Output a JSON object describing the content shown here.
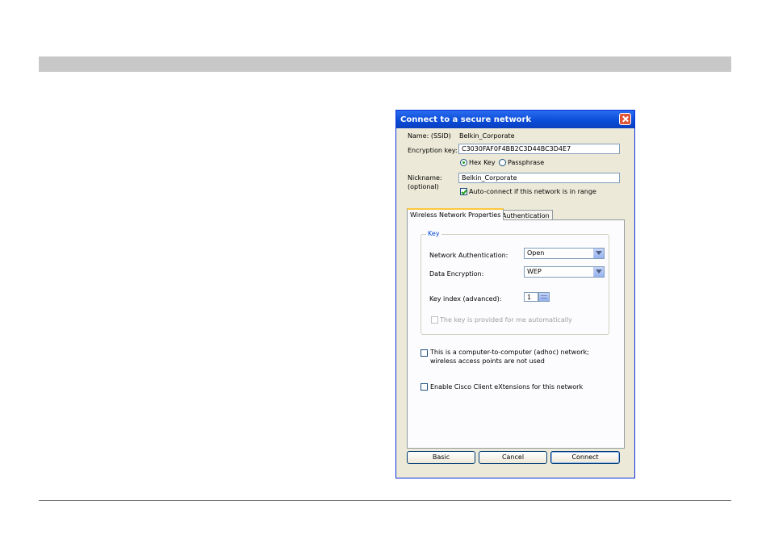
{
  "dialog": {
    "title": "Connect to a secure network",
    "name_label": "Name:  (SSID)",
    "ssid_value": "Belkin_Corporate",
    "encryption_label": "Encryption key:",
    "encryption_value": "C3030FAF0F4BB2C3D44BC3D4E7",
    "radio_hex": "Hex Key",
    "radio_passphrase": "Passphrase",
    "nickname_label": "Nickname:",
    "nickname_optional": "(optional)",
    "nickname_value": "Belkin_Corporate",
    "autoconnect_label": "Auto-connect if this network is in range",
    "tabs": [
      {
        "label": "Wireless Network Properties"
      },
      {
        "label": "Authentication"
      }
    ],
    "key_group_label": "Key",
    "net_auth_label": "Network Authentication:",
    "net_auth_value": "Open",
    "data_enc_label": "Data Encryption:",
    "data_enc_value": "WEP",
    "key_index_label": "Key index (advanced):",
    "key_index_value": "1",
    "auto_key_label": "The key is provided for me automatically",
    "adhoc_label_1": "This is a computer-to-computer (adhoc) network;",
    "adhoc_label_2": "wireless access points are not used",
    "cisco_label": "Enable Cisco Client eXtensions for this network",
    "buttons": {
      "basic": "Basic",
      "cancel": "Cancel",
      "connect": "Connect"
    }
  }
}
